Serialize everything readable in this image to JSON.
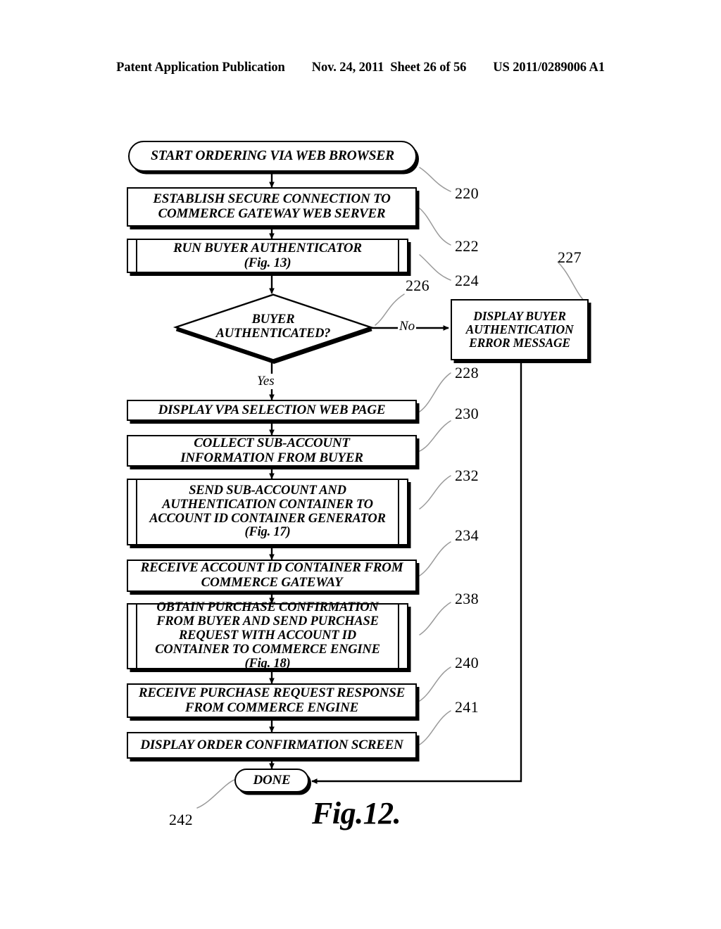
{
  "header": {
    "publication": "Patent Application Publication",
    "date": "Nov. 24, 2011",
    "sheet": "Sheet 26 of 56",
    "docnumber": "US 2011/0289006 A1"
  },
  "figure": {
    "caption": "Fig.12."
  },
  "nodes": {
    "start": "START ORDERING VIA WEB BROWSER",
    "establish": "ESTABLISH SECURE CONNECTION TO\nCOMMERCE GATEWAY WEB SERVER",
    "run_auth": "RUN BUYER AUTHENTICATOR\n(Fig. 13)",
    "decision": "BUYER\nAUTHENTICATED?",
    "error": "DISPLAY BUYER\nAUTHENTICATION\nERROR MESSAGE",
    "display_vpa": "DISPLAY VPA SELECTION WEB PAGE",
    "collect": "COLLECT SUB-ACCOUNT\nINFORMATION FROM BUYER",
    "send_sub": "SEND SUB-ACCOUNT AND\nAUTHENTICATION CONTAINER TO\nACCOUNT ID CONTAINER GENERATOR\n(Fig. 17)",
    "receive_container": "RECEIVE ACCOUNT ID CONTAINER FROM\nCOMMERCE GATEWAY",
    "obtain_purchase": "OBTAIN PURCHASE CONFIRMATION\nFROM BUYER AND SEND PURCHASE\nREQUEST WITH ACCOUNT ID\nCONTAINER TO COMMERCE ENGINE\n(Fig. 18)",
    "receive_response": "RECEIVE PURCHASE REQUEST RESPONSE\nFROM COMMERCE ENGINE",
    "display_order": "DISPLAY ORDER CONFIRMATION SCREEN",
    "done": "DONE"
  },
  "branches": {
    "no": "No",
    "yes": "Yes"
  },
  "refnums": {
    "n220": "220",
    "n222": "222",
    "n224": "224",
    "n226": "226",
    "n227": "227",
    "n228": "228",
    "n230": "230",
    "n232": "232",
    "n234": "234",
    "n238": "238",
    "n240": "240",
    "n241": "241",
    "n242": "242"
  },
  "colors": {
    "ink": "#000000",
    "paper": "#ffffff",
    "leader": "#8a8a8a"
  }
}
